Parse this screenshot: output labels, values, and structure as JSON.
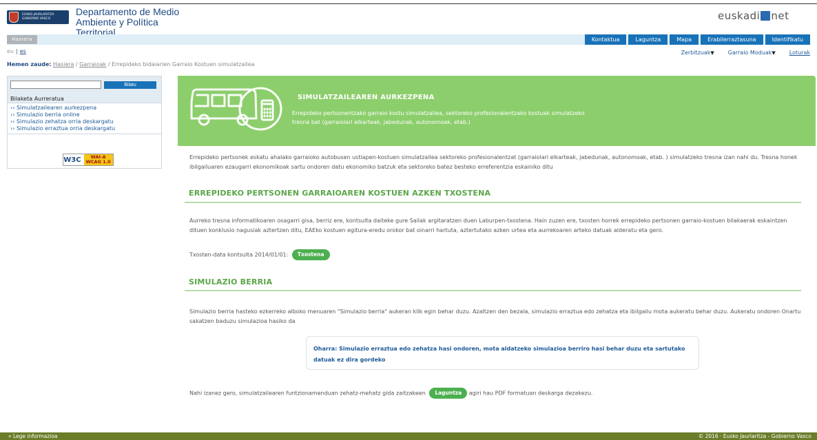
{
  "header": {
    "logo_text_line1": "EUSKO JAURLARITZA",
    "logo_text_line2": "GOBIERNO VASCO",
    "dept_title": "Departamento de Medio Ambiente y Política Territorial",
    "euskadi_logo_left": "euskadi",
    "euskadi_logo_right": "net"
  },
  "navbar": {
    "home": "Hasiera",
    "buttons": [
      "Kontaktua",
      "Laguntza",
      "Mapa",
      "Erabilerraztasuna",
      "Identifikatu"
    ]
  },
  "languages": {
    "eu": "eu",
    "es": "es"
  },
  "subnav": {
    "items": [
      "Zerbitzuak",
      "Garraio Moduak"
    ],
    "loturak": "Loturak"
  },
  "breadcrumb": {
    "label": "Hemen zaude:",
    "items": [
      "Hasiera",
      "Garraioak",
      "Errepideko bidaiarien Garraio Kostuen simulatzailea"
    ]
  },
  "sidebar": {
    "search_placeholder": "",
    "search_button": "Bilatu",
    "advanced_search": "Bilaketa Aurreratua",
    "links": [
      "Simulatzailearen aurkezpena",
      "Simulazio berria online",
      "Simulazio zehatza orria deskargatu",
      "Simulazio erraztua orria deskargatu"
    ],
    "wai_w3c": "W3C",
    "wai_level": "WAI-A",
    "wai_wcag": "WCAG 1.0"
  },
  "banner": {
    "title": "SIMULATZAILEAREN AURKEZPENA",
    "description": "Errepideko pertsonentzako garraio kostu simulatzailea, sektoreko profesionalentzako kostuak simulatzeko tresna bat (garraiolari elkarteak, jabedunak, autonomoak, etab.)"
  },
  "content": {
    "intro": "Errepideko pertsonek eskatu ahalako garraioko autobusen ustiapen-kostuen simulatzailea sektoreko profesionalentzat (garraiolari elkarteak, jabedunak, autonomoak, etab. ) simulatzeko tresna izan nahi du. Tresna honek ibilgailuaren ezaugarri ekonomikoak sartu ondoren datu ekonomiko batzuk eta sektoreko batez besteko erreferentzia eskainiko ditu",
    "section1_title": "ERREPIDEKO PERTSONEN GARRAIOAREN KOSTUEN AZKEN TXOSTENA",
    "section1_para": "Aurreko tresna informatikoaren osagarri gisa, berriz ere, kontsulta daiteke gure Sailak argitaratzen duen Laburpen-txostena. Hain zuzen ere, txosten horrek errepideko pertsonen garraio-kostuen bilakaerak eskaintzen dituen konklusio nagusiak aztertzen ditu, EAEko kostuen egitura-eredu orokor bat oinarri hartuta, aztertutako azken urtea eta aurrekoaren arteko datuak alderatu eta gero.",
    "report_date_text": "Txosten-data kontsulta 2014/01/01:",
    "report_button": "Txostena",
    "section2_title": "SIMULAZIO BERRIA",
    "section2_para": "Simulazio berria hasteko ezkerreko alboko menuaren \"Simulazio berria\" aukeran klik egin behar duzu. Azaltzen den bezala, simulazio erraztua edo zehatza eta ibilgailu mota aukeratu behar duzu. Aukeratu ondoren Onartu sakatzen baduzu simulazioa hasiko da",
    "note": "Oharra: Simulazio erraztua edo zehatza hasi ondoren, mota aldatzeko simulazioa berriro hasi behar duzu eta sartutako datuak ez dira gordeko",
    "help_text_before": "Nahi izanez gero, simulatzailearen funtzionamenduan zehatz-mehatz gida zaitzakeen",
    "help_button": "Laguntza",
    "help_text_after": "agiri hau PDF formatuan deskarga dezakezu."
  },
  "footer": {
    "legal": "Lege informazioa",
    "copyright": "© 2016 · Eusko Jaurlaritza - Gobierno Vasco"
  }
}
